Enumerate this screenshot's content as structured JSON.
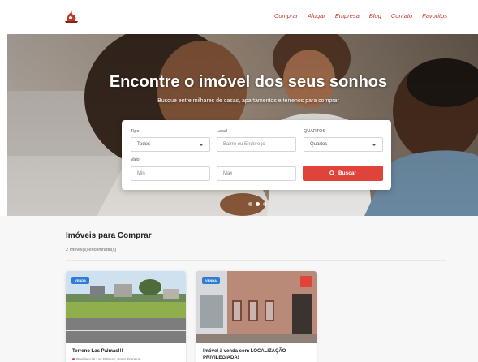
{
  "nav": {
    "items": [
      "Comprar",
      "Alugar",
      "Empresa",
      "Blog",
      "Contato",
      "Favoritos"
    ]
  },
  "hero": {
    "title": "Encontre o imóvel dos seus sonhos",
    "subtitle": "Busque entre milhares de casas, apartamentos e terrenos para comprar"
  },
  "search": {
    "tipo_label": "Tipo",
    "tipo_value": "Todos",
    "local_label": "Local",
    "local_placeholder": "Bairro ou Endereço",
    "quartos_label": "QUARTOS",
    "quartos_value": "Quartos",
    "valor_label": "Valor",
    "min_placeholder": "Min",
    "max_placeholder": "Max",
    "button_label": "Buscar"
  },
  "listing": {
    "title": "Imóveis para Comprar",
    "count": "2 imóvel(s) encontrado(s)",
    "cards": [
      {
        "badge": "VENDA",
        "title": "Terreno Las Palmas!!!",
        "location": "Residencial Las Palmas, Porto Ferreira"
      },
      {
        "badge": "VENDA",
        "title": "Imóvel à venda com LOCALIZAÇÃO PRIVILEGIADA!",
        "location": ""
      }
    ]
  },
  "colors": {
    "accent": "#e0433a",
    "nav": "#c0392b",
    "badge": "#2e7cd6"
  }
}
